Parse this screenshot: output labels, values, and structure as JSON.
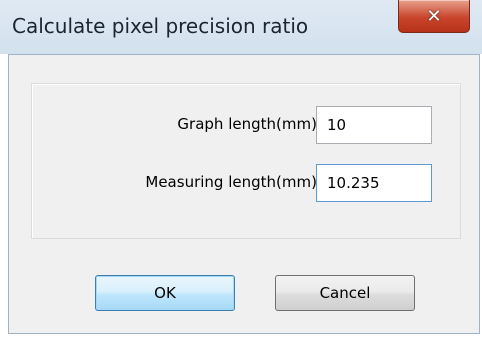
{
  "window": {
    "title": "Calculate pixel precision ratio",
    "close_icon": "close-icon"
  },
  "form": {
    "graph_length": {
      "label": "Graph length(mm):",
      "value": "10"
    },
    "measuring_length": {
      "label": "Measuring length(mm):",
      "value": "10.235"
    }
  },
  "buttons": {
    "ok_label": "OK",
    "cancel_label": "Cancel"
  },
  "colors": {
    "close_button": "#c9452c",
    "default_button_border": "#3c7fb1"
  }
}
